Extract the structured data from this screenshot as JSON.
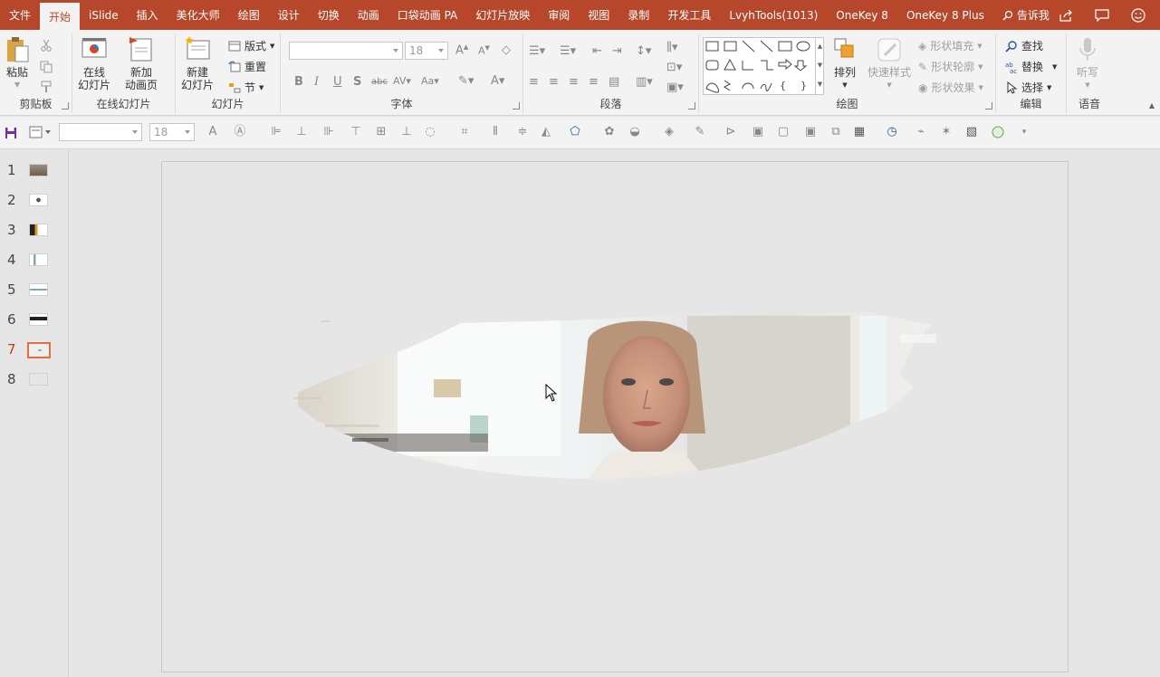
{
  "menu": {
    "tabs": [
      {
        "label": "文件",
        "active": false
      },
      {
        "label": "开始",
        "active": true
      },
      {
        "label": "iSlide",
        "active": false
      },
      {
        "label": "插入",
        "active": false
      },
      {
        "label": "美化大师",
        "active": false
      },
      {
        "label": "绘图",
        "active": false
      },
      {
        "label": "设计",
        "active": false
      },
      {
        "label": "切换",
        "active": false
      },
      {
        "label": "动画",
        "active": false
      },
      {
        "label": "口袋动画 PA",
        "active": false
      },
      {
        "label": "幻灯片放映",
        "active": false
      },
      {
        "label": "审阅",
        "active": false
      },
      {
        "label": "视图",
        "active": false
      },
      {
        "label": "录制",
        "active": false
      },
      {
        "label": "开发工具",
        "active": false
      },
      {
        "label": "LvyhTools(1013)",
        "active": false
      },
      {
        "label": "OneKey 8",
        "active": false
      },
      {
        "label": "OneKey 8 Plus",
        "active": false
      }
    ],
    "tell_me": "告诉我"
  },
  "ribbon": {
    "clipboard": {
      "label": "剪贴板",
      "paste": "粘贴"
    },
    "online_slides": {
      "label": "在线幻灯片",
      "online": "在线\n幻灯片",
      "new_anim": "新加\n动画页"
    },
    "slides": {
      "label": "幻灯片",
      "new_slide": "新建\n幻灯片",
      "layout": "版式",
      "reset": "重置",
      "section": "节"
    },
    "font": {
      "label": "字体",
      "size": "18"
    },
    "paragraph": {
      "label": "段落"
    },
    "drawing": {
      "label": "绘图",
      "arrange": "排列",
      "quick_styles": "快速样式",
      "fill": "形状填充",
      "outline": "形状轮廓",
      "effects": "形状效果"
    },
    "editing": {
      "label": "编辑",
      "find": "查找",
      "replace": "替换",
      "select": "选择"
    },
    "voice": {
      "label": "语音",
      "dictate": "听写"
    }
  },
  "qat": {
    "font_size": "18"
  },
  "slides": [
    {
      "num": "1",
      "active": false
    },
    {
      "num": "2",
      "active": false
    },
    {
      "num": "3",
      "active": false
    },
    {
      "num": "4",
      "active": false
    },
    {
      "num": "5",
      "active": false
    },
    {
      "num": "6",
      "active": false
    },
    {
      "num": "7",
      "active": true
    },
    {
      "num": "8",
      "active": false
    }
  ],
  "colors": {
    "accent": "#b7472a",
    "selected_thumb": "#e2703f"
  }
}
